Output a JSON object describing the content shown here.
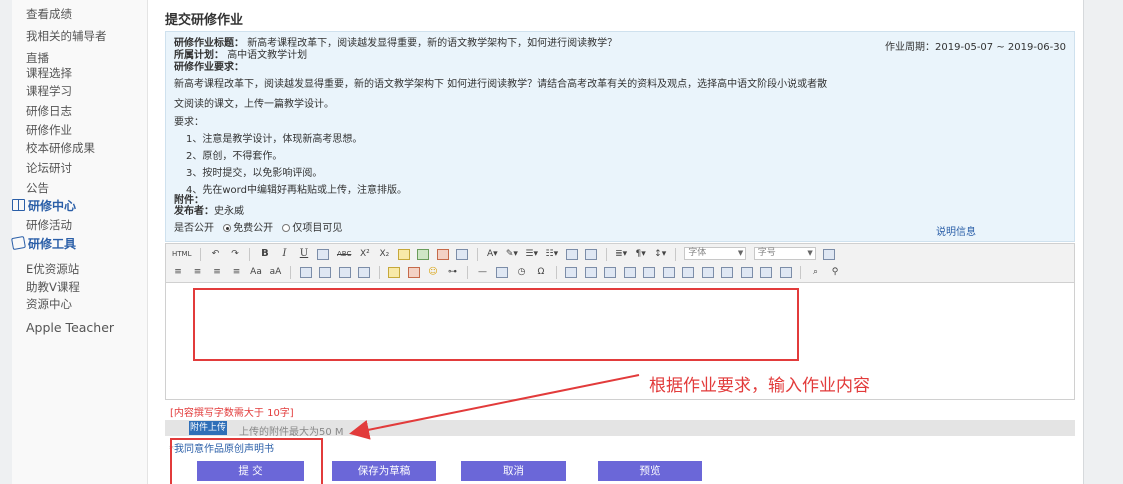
{
  "sidebar": {
    "items": [
      {
        "label": "查看成绩"
      },
      {
        "label": "我相关的辅导者"
      },
      {
        "label": "直播"
      },
      {
        "label": "课程选择"
      },
      {
        "label": "课程学习"
      },
      {
        "label": "研修日志"
      },
      {
        "label": "研修作业"
      },
      {
        "label": "校本研修成果"
      },
      {
        "label": "论坛研讨"
      },
      {
        "label": "公告"
      }
    ],
    "section_center": {
      "label": "研修中心",
      "icon": "book-icon"
    },
    "center_items": [
      {
        "label": "研修活动"
      }
    ],
    "section_tools": {
      "label": "研修工具",
      "icon": "tools-icon"
    },
    "tool_items": [
      {
        "label": "E优资源站"
      },
      {
        "label": "助教V课程"
      },
      {
        "label": "资源中心"
      },
      {
        "label": "Apple Teacher"
      }
    ]
  },
  "page": {
    "title": "提交研修作业"
  },
  "assignment": {
    "title_label": "研修作业标题：",
    "title_value": "新高考课程改革下，阅读越发显得重要，新的语文教学架构下，如何进行阅读教学？",
    "period_label": "作业周期：",
    "period_value": "2019-05-07 ~ 2019-06-30",
    "plan_label": "所属计划：",
    "plan_value": "高中语文教学计划",
    "requirements_label": "研修作业要求：",
    "requirements_line1": "新高考课程改革下，阅读越发显得重要，新的语文教学架构下  如何进行阅读教学？请结合高考改革有关的资料及观点，选择高中语文阶段小说或者散",
    "requirements_line2": "文阅读的课文，上传一篇教学设计。",
    "demands_label": "要求：",
    "demands": [
      "1、注意是教学设计，体现新高考思想。",
      "2、原创，不得套作。",
      "3、按时提交，以免影响评阅。",
      "4、先在word中编辑好再粘贴或上传，注意排版。"
    ],
    "attachment_label": "附件：",
    "publisher_label": "发布者：",
    "publisher_value": "史永威",
    "public_label": "是否公开",
    "public_options": [
      "免费公开",
      "仅项目可见"
    ],
    "public_selected": "免费公开",
    "explain_link": "说明信息"
  },
  "toolbar": {
    "font_family_placeholder": "字体",
    "font_size_placeholder": "字号",
    "row1_glyphs": [
      "HTML",
      "↶",
      "↷",
      "B",
      "I",
      "U",
      "A",
      "ABC",
      "X²",
      "X₂",
      "A",
      "Ω"
    ],
    "html_label": "HTML"
  },
  "editor": {
    "annotation": "根据作业要求，输入作业内容",
    "word_count_hint": "[内容撰写字数需大于 10字]"
  },
  "attachment": {
    "button_label": "附件上传",
    "note": "上传的附件最大为50 M"
  },
  "agreement": {
    "star": "*",
    "text": "我同意作品原创声明书"
  },
  "actions": {
    "submit": "提 交",
    "save_draft": "保存为草稿",
    "cancel": "取消",
    "preview": "预览"
  },
  "colors": {
    "accent": "#6b67d8",
    "annotation_red": "#e23b3b",
    "info_bg": "#eaf4fb",
    "link_blue": "#2b5fa8"
  }
}
